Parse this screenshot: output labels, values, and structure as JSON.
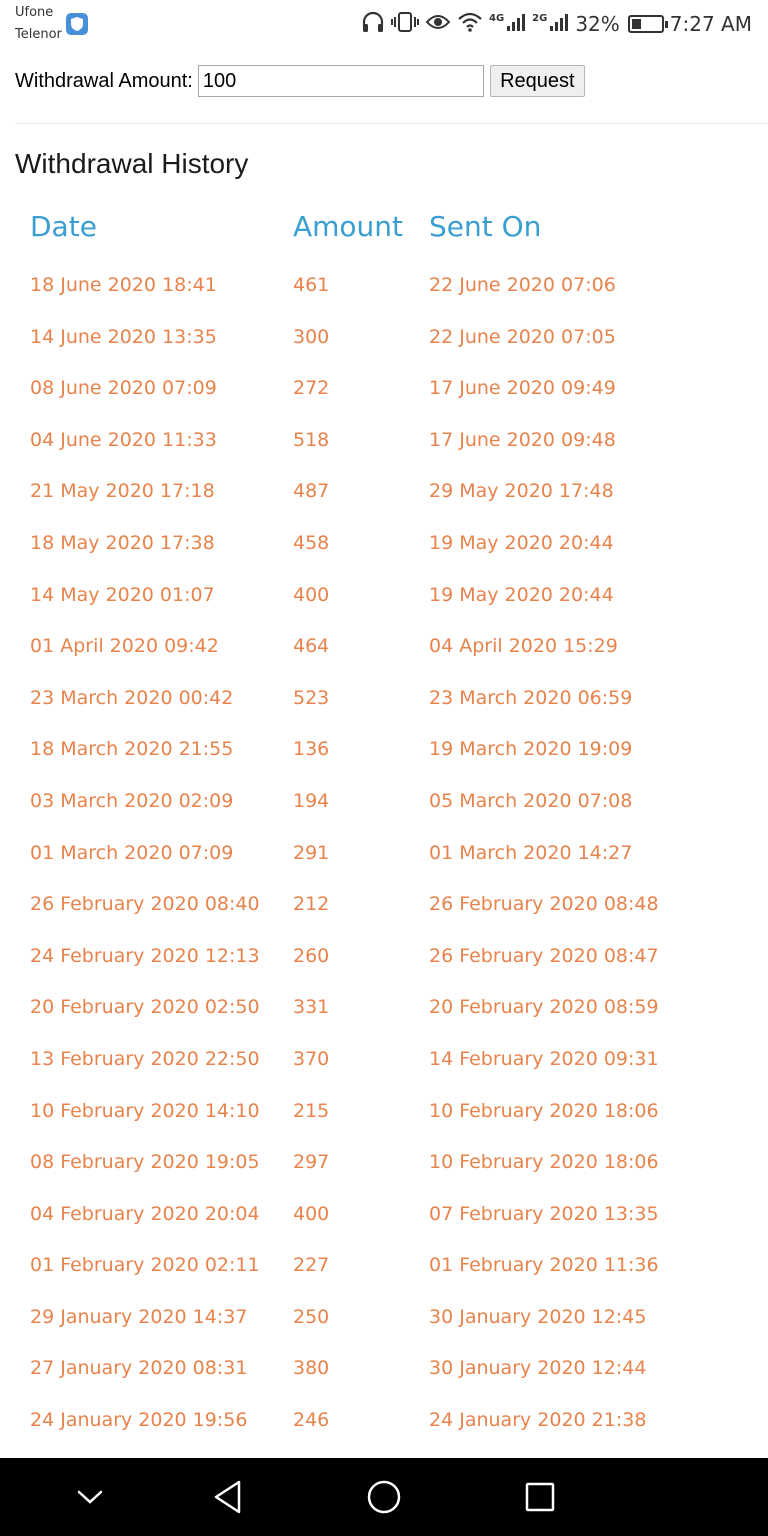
{
  "status_bar": {
    "carrier_1": "Ufone",
    "carrier_2": "Telenor",
    "network_1": "4G",
    "network_2": "2G",
    "battery": "32%",
    "battery_level": 0.32,
    "time": "7:27 AM"
  },
  "form": {
    "label": "Withdrawal Amount:",
    "amount_value": "100",
    "request_label": "Request"
  },
  "history": {
    "title": "Withdrawal History",
    "columns": [
      "Date",
      "Amount",
      "Sent On"
    ],
    "rows": [
      [
        "18 June 2020 18:41",
        "461",
        "22 June 2020 07:06"
      ],
      [
        "14 June 2020 13:35",
        "300",
        "22 June 2020 07:05"
      ],
      [
        "08 June 2020 07:09",
        "272",
        "17 June 2020 09:49"
      ],
      [
        "04 June 2020 11:33",
        "518",
        "17 June 2020 09:48"
      ],
      [
        "21 May 2020 17:18",
        "487",
        "29 May 2020 17:48"
      ],
      [
        "18 May 2020 17:38",
        "458",
        "19 May 2020 20:44"
      ],
      [
        "14 May 2020 01:07",
        "400",
        "19 May 2020 20:44"
      ],
      [
        "01 April 2020 09:42",
        "464",
        "04 April 2020 15:29"
      ],
      [
        "23 March 2020 00:42",
        "523",
        "23 March 2020 06:59"
      ],
      [
        "18 March 2020 21:55",
        "136",
        "19 March 2020 19:09"
      ],
      [
        "03 March 2020 02:09",
        "194",
        "05 March 2020 07:08"
      ],
      [
        "01 March 2020 07:09",
        "291",
        "01 March 2020 14:27"
      ],
      [
        "26 February 2020 08:40",
        "212",
        "26 February 2020 08:48"
      ],
      [
        "24 February 2020 12:13",
        "260",
        "26 February 2020 08:47"
      ],
      [
        "20 February 2020 02:50",
        "331",
        "20 February 2020 08:59"
      ],
      [
        "13 February 2020 22:50",
        "370",
        "14 February 2020 09:31"
      ],
      [
        "10 February 2020 14:10",
        "215",
        "10 February 2020 18:06"
      ],
      [
        "08 February 2020 19:05",
        "297",
        "10 February 2020 18:06"
      ],
      [
        "04 February 2020 20:04",
        "400",
        "07 February 2020 13:35"
      ],
      [
        "01 February 2020 02:11",
        "227",
        "01 February 2020 11:36"
      ],
      [
        "29 January 2020 14:37",
        "250",
        "30 January 2020 12:45"
      ],
      [
        "27 January 2020 08:31",
        "380",
        "30 January 2020 12:44"
      ],
      [
        "24 January 2020 19:56",
        "246",
        "24 January 2020 21:38"
      ]
    ]
  },
  "colors": {
    "header_blue": "#3a9ed1",
    "value_orange": "#e8834c",
    "nav_bar": "#000000"
  },
  "nav": {
    "buttons": [
      "chevron-down-icon",
      "back-icon",
      "home-icon",
      "recents-icon"
    ]
  }
}
